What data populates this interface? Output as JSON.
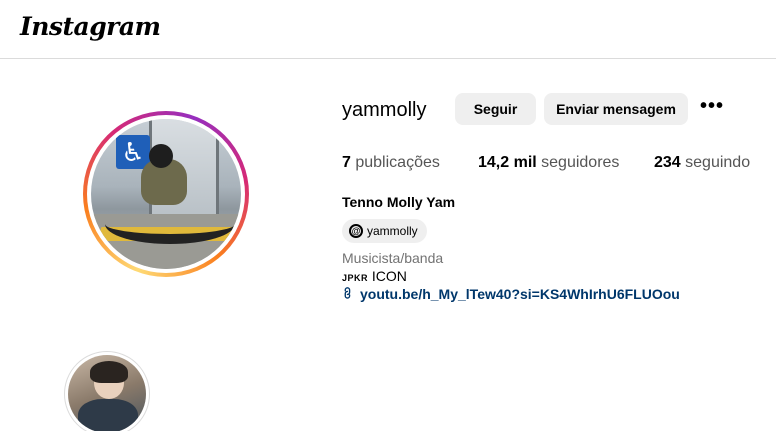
{
  "header": {
    "logo_text": "Instagram"
  },
  "profile": {
    "username": "yammolly",
    "follow_label": "Seguir",
    "message_label": "Enviar mensagem",
    "more_label": "•••",
    "stats": {
      "posts_count": "7",
      "posts_label": "publicações",
      "followers_count": "14,2 mil",
      "followers_label": "seguidores",
      "following_count": "234",
      "following_label": "seguindo"
    },
    "full_name": "Tenno Molly Yam",
    "threads_handle": "yammolly",
    "category": "Musicista/banda",
    "bio_tag": "JPKR",
    "bio_text": "ICON",
    "link": "youtu.be/h_My_lTew40?si=KS4WhIrhU6FLUOou"
  },
  "icons": {
    "accessibility_sign": "♿",
    "threads": "@",
    "link": "🔗"
  },
  "colors": {
    "button_bg": "#efefef",
    "link": "#00376b",
    "secondary_text": "#737373",
    "story_ring": [
      "#feda75",
      "#fa7e1e",
      "#d62976",
      "#962fbf"
    ]
  }
}
